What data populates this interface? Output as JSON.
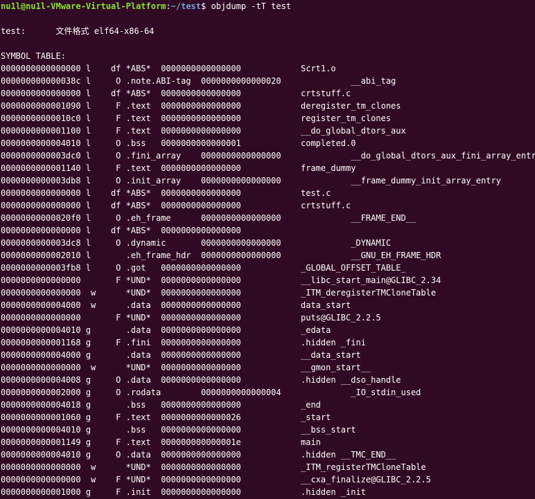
{
  "prompt": {
    "user_host": "nu1l@nu1l-VMware-Virtual-Platform",
    "colon": ":",
    "path": "~/test",
    "dollar": "$",
    "command": " objdump -tT test"
  },
  "file_line": "test:      文件格式 elf64-x86-64",
  "symbol_table_header": "SYMBOL TABLE:",
  "rows": [
    {
      "left": "0000000000000000 l    df *ABS*  0000000000000000",
      "name": "Scrt1.o"
    },
    {
      "left": "000000000000038c l     O .note.ABI-tag  0000000000000020",
      "name": "          __abi_tag"
    },
    {
      "left": "0000000000000000 l    df *ABS*  0000000000000000",
      "name": "crtstuff.c"
    },
    {
      "left": "0000000000001090 l     F .text  0000000000000000",
      "name": "deregister_tm_clones"
    },
    {
      "left": "00000000000010c0 l     F .text  0000000000000000",
      "name": "register_tm_clones"
    },
    {
      "left": "0000000000001100 l     F .text  0000000000000000",
      "name": "__do_global_dtors_aux"
    },
    {
      "left": "0000000000004010 l     O .bss   0000000000000001",
      "name": "completed.0"
    },
    {
      "left": "0000000000003dc0 l     O .fini_array    0000000000000000",
      "name": "          __do_global_dtors_aux_fini_array_entry"
    },
    {
      "left": "0000000000001140 l     F .text  0000000000000000",
      "name": "frame_dummy"
    },
    {
      "left": "0000000000003db8 l     O .init_array    0000000000000000",
      "name": "          __frame_dummy_init_array_entry"
    },
    {
      "left": "0000000000000000 l    df *ABS*  0000000000000000",
      "name": "test.c"
    },
    {
      "left": "0000000000000000 l    df *ABS*  0000000000000000",
      "name": "crtstuff.c"
    },
    {
      "left": "00000000000020f0 l     O .eh_frame      0000000000000000",
      "name": "          __FRAME_END__"
    },
    {
      "left": "0000000000000000 l    df *ABS*  0000000000000000",
      "name": ""
    },
    {
      "left": "0000000000003dc8 l     O .dynamic       0000000000000000",
      "name": "          _DYNAMIC"
    },
    {
      "left": "0000000000002010 l       .eh_frame_hdr  0000000000000000",
      "name": "          __GNU_EH_FRAME_HDR"
    },
    {
      "left": "0000000000003fb8 l     O .got   0000000000000000",
      "name": "_GLOBAL_OFFSET_TABLE_"
    },
    {
      "left": "0000000000000000       F *UND*  0000000000000000",
      "name": "__libc_start_main@GLIBC_2.34"
    },
    {
      "left": "0000000000000000  w      *UND*  0000000000000000",
      "name": "_ITM_deregisterTMCloneTable"
    },
    {
      "left": "0000000000004000  w      .data  0000000000000000",
      "name": "data_start"
    },
    {
      "left": "0000000000000000       F *UND*  0000000000000000",
      "name": "puts@GLIBC_2.2.5"
    },
    {
      "left": "0000000000004010 g       .data  0000000000000000",
      "name": "_edata"
    },
    {
      "left": "0000000000001168 g     F .fini  0000000000000000",
      "name": ".hidden _fini"
    },
    {
      "left": "0000000000004000 g       .data  0000000000000000",
      "name": "__data_start"
    },
    {
      "left": "0000000000000000  w      *UND*  0000000000000000",
      "name": "__gmon_start__"
    },
    {
      "left": "0000000000004008 g     O .data  0000000000000000",
      "name": ".hidden __dso_handle"
    },
    {
      "left": "0000000000002000 g     O .rodata        0000000000000004",
      "name": "          _IO_stdin_used"
    },
    {
      "left": "0000000000004018 g       .bss   0000000000000000",
      "name": "_end"
    },
    {
      "left": "0000000000001060 g     F .text  0000000000000026",
      "name": "_start"
    },
    {
      "left": "0000000000004010 g       .bss   0000000000000000",
      "name": "__bss_start"
    },
    {
      "left": "0000000000001149 g     F .text  000000000000001e",
      "name": "main"
    },
    {
      "left": "0000000000004010 g     O .data  0000000000000000",
      "name": ".hidden __TMC_END__"
    },
    {
      "left": "0000000000000000  w      *UND*  0000000000000000",
      "name": "_ITM_registerTMCloneTable"
    },
    {
      "left": "0000000000000000  w    F *UND*  0000000000000000",
      "name": "__cxa_finalize@GLIBC_2.2.5"
    },
    {
      "left": "0000000000001000 g     F .init  0000000000000000",
      "name": ".hidden _init"
    }
  ],
  "colors": {
    "background": "#300a24",
    "text": "#ffffff",
    "prompt_user": "#8ae234",
    "prompt_path": "#729fcf"
  }
}
